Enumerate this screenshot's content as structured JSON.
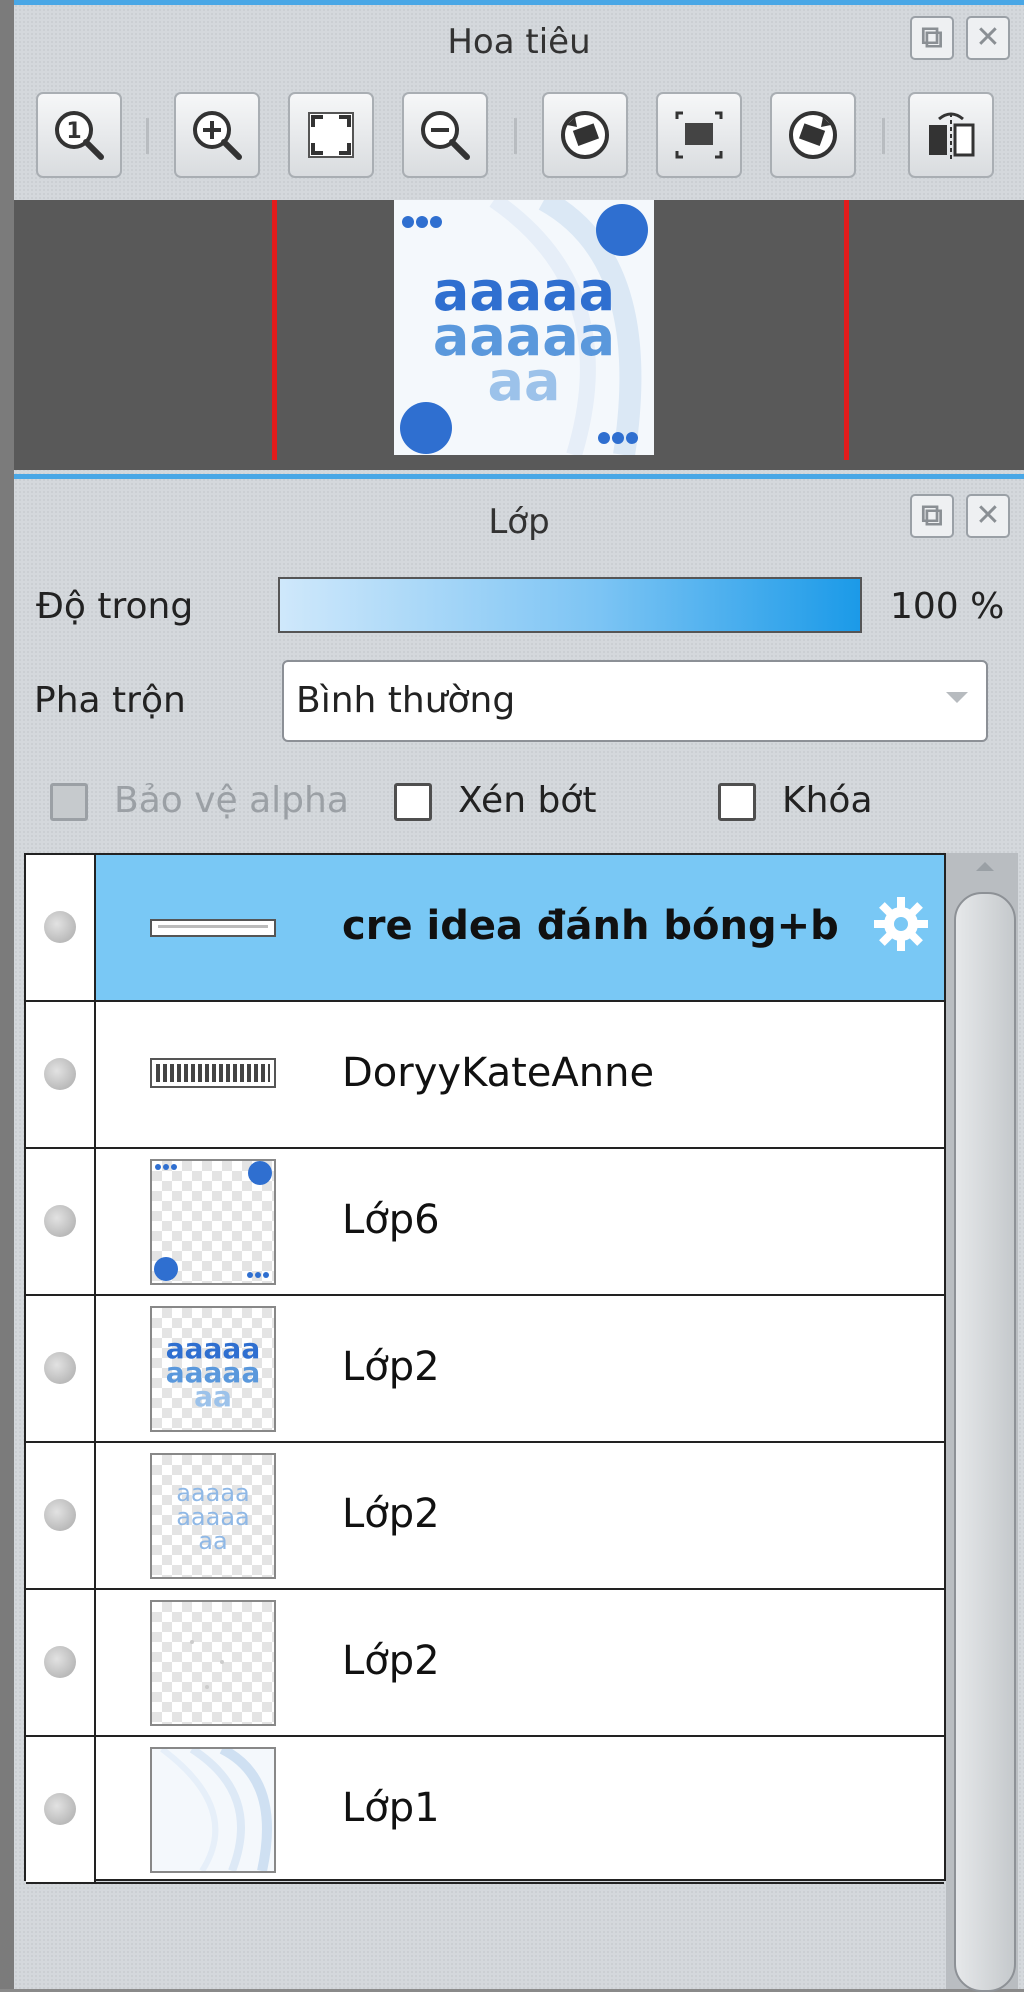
{
  "navigator": {
    "title": "Hoa tiêu",
    "buttons": [
      "actual-size",
      "zoom-in",
      "fit-to-window",
      "zoom-out",
      "rotate-left",
      "reset-view",
      "rotate-right",
      "flip-horizontal"
    ],
    "thumb_letters": [
      "aaaaa",
      "aaaaa",
      "aa"
    ]
  },
  "layers_panel": {
    "title": "Lớp",
    "opacity_label": "Độ trong",
    "opacity_value": "100 %",
    "opacity_fraction": 1.0,
    "blend_label": "Pha trộn",
    "blend_value": "Bình thường",
    "protect_alpha_label": "Bảo vệ alpha",
    "clipping_label": "Xén bớt",
    "lock_label": "Khóa",
    "layers": [
      {
        "name": "cre idea đánh bóng+b",
        "selected": true
      },
      {
        "name": "DoryyKateAnne",
        "selected": false
      },
      {
        "name": "Lớp6",
        "selected": false
      },
      {
        "name": "Lớp2",
        "selected": false
      },
      {
        "name": "Lớp2",
        "selected": false
      },
      {
        "name": "Lớp2",
        "selected": false
      },
      {
        "name": "Lớp1",
        "selected": false
      }
    ]
  },
  "colors": {
    "accent": "#49a7e6",
    "selected_row": "#79c8f5",
    "thumb_blue": "#2f6fd0",
    "thumb_light_blue": "#7db4e6"
  }
}
